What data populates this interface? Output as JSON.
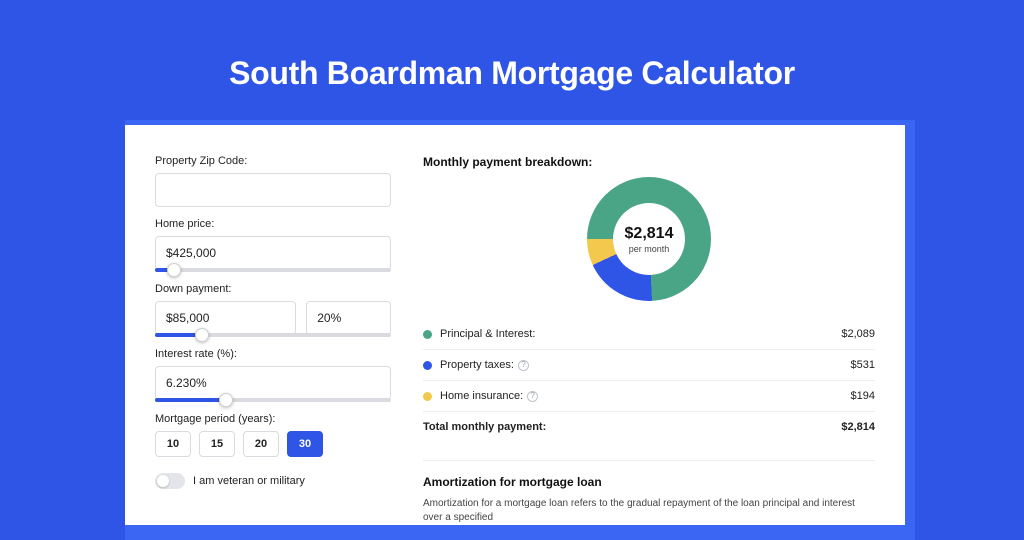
{
  "title": "South Boardman Mortgage Calculator",
  "form": {
    "zip_label": "Property Zip Code:",
    "zip_value": "",
    "home_price_label": "Home price:",
    "home_price_value": "$425,000",
    "home_price_slider_pct": 8,
    "down_payment_label": "Down payment:",
    "down_payment_value": "$85,000",
    "down_payment_pct_value": "20%",
    "down_payment_slider_pct": 20,
    "interest_label": "Interest rate (%):",
    "interest_value": "6.230%",
    "interest_slider_pct": 30,
    "period_label": "Mortgage period (years):",
    "period_options": [
      "10",
      "15",
      "20",
      "30"
    ],
    "period_selected": "30",
    "veteran_label": "I am veteran or military"
  },
  "breakdown": {
    "heading": "Monthly payment breakdown:",
    "donut_amount": "$2,814",
    "donut_sub": "per month",
    "items": [
      {
        "label": "Principal & Interest:",
        "value": "$2,089",
        "color": "#4aa586",
        "info": false
      },
      {
        "label": "Property taxes:",
        "value": "$531",
        "color": "#2e55e5",
        "info": true
      },
      {
        "label": "Home insurance:",
        "value": "$194",
        "color": "#f2c94c",
        "info": true
      }
    ],
    "total_label": "Total monthly payment:",
    "total_value": "$2,814"
  },
  "amortization": {
    "title": "Amortization for mortgage loan",
    "text": "Amortization for a mortgage loan refers to the gradual repayment of the loan principal and interest over a specified"
  },
  "chart_data": {
    "type": "pie",
    "title": "Monthly payment breakdown",
    "total": 2814,
    "series": [
      {
        "name": "Principal & Interest",
        "value": 2089,
        "color": "#4aa586"
      },
      {
        "name": "Property taxes",
        "value": 531,
        "color": "#2e55e5"
      },
      {
        "name": "Home insurance",
        "value": 194,
        "color": "#f2c94c"
      }
    ]
  }
}
